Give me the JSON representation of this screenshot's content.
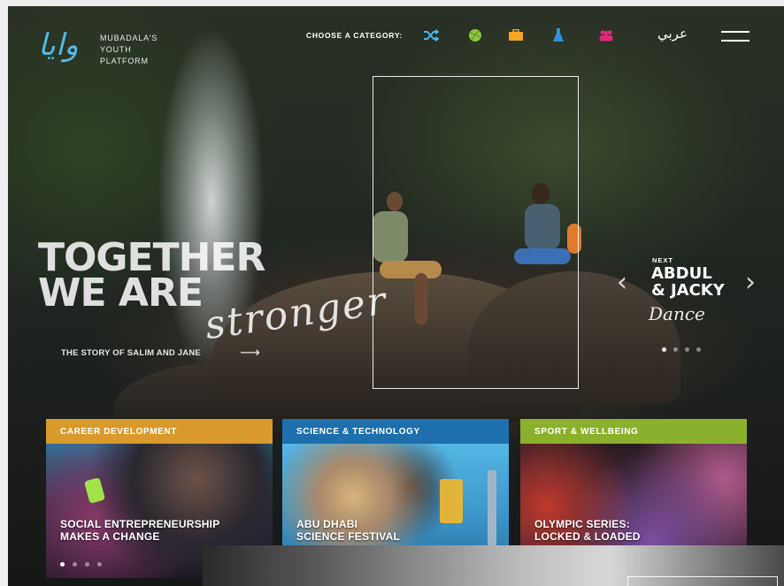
{
  "header": {
    "logo_arabic": "وايا",
    "logo_lines": [
      "MUBADALA'S",
      "YOUTH",
      "PLATFORM"
    ],
    "category_label": "CHOOSE A CATEGORY:",
    "categories": [
      {
        "icon": "shuffle-icon",
        "color": "#4fb3e6"
      },
      {
        "icon": "ball-icon",
        "color": "#8cc63f"
      },
      {
        "icon": "briefcase-icon",
        "color": "#f4a623"
      },
      {
        "icon": "flask-icon",
        "color": "#2f8fd8"
      },
      {
        "icon": "people-icon",
        "color": "#e2267a"
      }
    ],
    "language": "عربي"
  },
  "hero": {
    "title_lines": [
      "TOGETHER",
      "WE ARE"
    ],
    "script_word": "stronger",
    "story_link": "THE STORY OF SALIM AND JANE"
  },
  "next": {
    "label": "NEXT",
    "title_lines": [
      "ABDUL",
      "& JACKY"
    ],
    "script_word": "Dance",
    "slide_count": 4,
    "active_slide": 1
  },
  "cards": [
    {
      "category": "CAREER DEVELOPMENT",
      "color": "#d99a2b",
      "caption_lines": [
        "SOCIAL ENTREPRENEURSHIP",
        "MAKES A CHANGE"
      ]
    },
    {
      "category": "SCIENCE & TECHNOLOGY",
      "color": "#1d6fae",
      "caption_lines": [
        "ABU DHABI",
        "SCIENCE FESTIVAL"
      ]
    },
    {
      "category": "SPORT & WELLBEING",
      "color": "#8bb12c",
      "caption_lines": [
        "OLYMPIC SERIES:",
        "LOCKED & LOADED"
      ]
    }
  ]
}
